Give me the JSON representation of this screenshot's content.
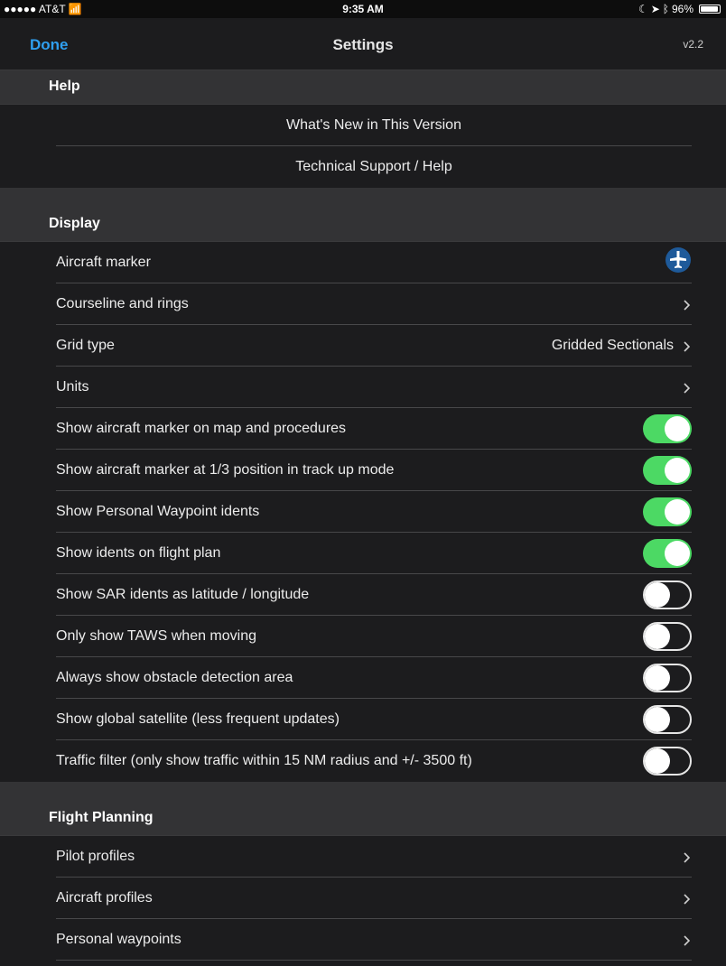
{
  "status_bar": {
    "carrier": "●●●●● AT&T",
    "time": "9:35 AM",
    "battery": "96%",
    "battery_level": 0.96
  },
  "nav": {
    "done_label": "Done",
    "title": "Settings",
    "version": "v2.2"
  },
  "help": {
    "header": "Help",
    "items": [
      {
        "label": "What's New in This Version"
      },
      {
        "label": "Technical Support / Help"
      }
    ]
  },
  "display": {
    "header": "Display",
    "aircraft_marker_label": "Aircraft marker",
    "aircraft_marker_icon": "airplane-icon",
    "courseline_label": "Courseline and rings",
    "grid_type_label": "Grid type",
    "grid_type_value": "Gridded Sectionals",
    "units_label": "Units",
    "toggles": [
      {
        "label": "Show aircraft marker on map and procedures",
        "on": true
      },
      {
        "label": "Show aircraft marker at 1/3 position in track up mode",
        "on": true
      },
      {
        "label": "Show Personal Waypoint idents",
        "on": true
      },
      {
        "label": "Show idents on flight plan",
        "on": true
      },
      {
        "label": "Show SAR idents as latitude / longitude",
        "on": false
      },
      {
        "label": "Only show TAWS when moving",
        "on": false
      },
      {
        "label": "Always show obstacle detection area",
        "on": false
      },
      {
        "label": "Show global satellite (less frequent updates)",
        "on": false
      },
      {
        "label": "Traffic filter (only show traffic within 15 NM radius and +/- 3500 ft)",
        "on": false
      }
    ]
  },
  "flight_planning": {
    "header": "Flight Planning",
    "items": [
      {
        "label": "Pilot profiles"
      },
      {
        "label": "Aircraft profiles"
      },
      {
        "label": "Personal waypoints"
      }
    ]
  },
  "colors": {
    "accent": "#2f9ff0",
    "toggle_on": "#4cd964",
    "background": "#1c1c1e",
    "section_header": "#333335"
  }
}
